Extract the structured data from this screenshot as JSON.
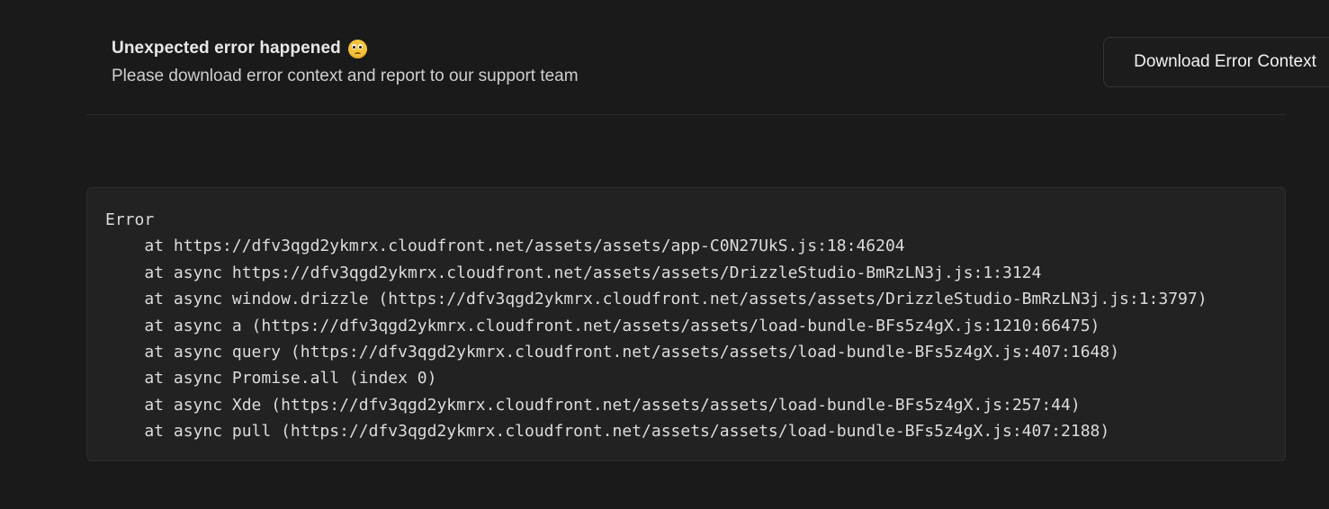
{
  "header": {
    "title": "Unexpected error happened",
    "emoji_icon": "confused-face-icon",
    "subtitle": "Please download error context and report to our support team",
    "download_button_label": "Download Error Context"
  },
  "stack_trace": {
    "lines": [
      "Error",
      "    at https://dfv3qgd2ykmrx.cloudfront.net/assets/assets/app-C0N27UkS.js:18:46204",
      "    at async https://dfv3qgd2ykmrx.cloudfront.net/assets/assets/DrizzleStudio-BmRzLN3j.js:1:3124",
      "    at async window.drizzle (https://dfv3qgd2ykmrx.cloudfront.net/assets/assets/DrizzleStudio-BmRzLN3j.js:1:3797)",
      "    at async a (https://dfv3qgd2ykmrx.cloudfront.net/assets/assets/load-bundle-BFs5z4gX.js:1210:66475)",
      "    at async query (https://dfv3qgd2ykmrx.cloudfront.net/assets/assets/load-bundle-BFs5z4gX.js:407:1648)",
      "    at async Promise.all (index 0)",
      "    at async Xde (https://dfv3qgd2ykmrx.cloudfront.net/assets/assets/load-bundle-BFs5z4gX.js:257:44)",
      "    at async pull (https://dfv3qgd2ykmrx.cloudfront.net/assets/assets/load-bundle-BFs5z4gX.js:407:2188)"
    ]
  }
}
